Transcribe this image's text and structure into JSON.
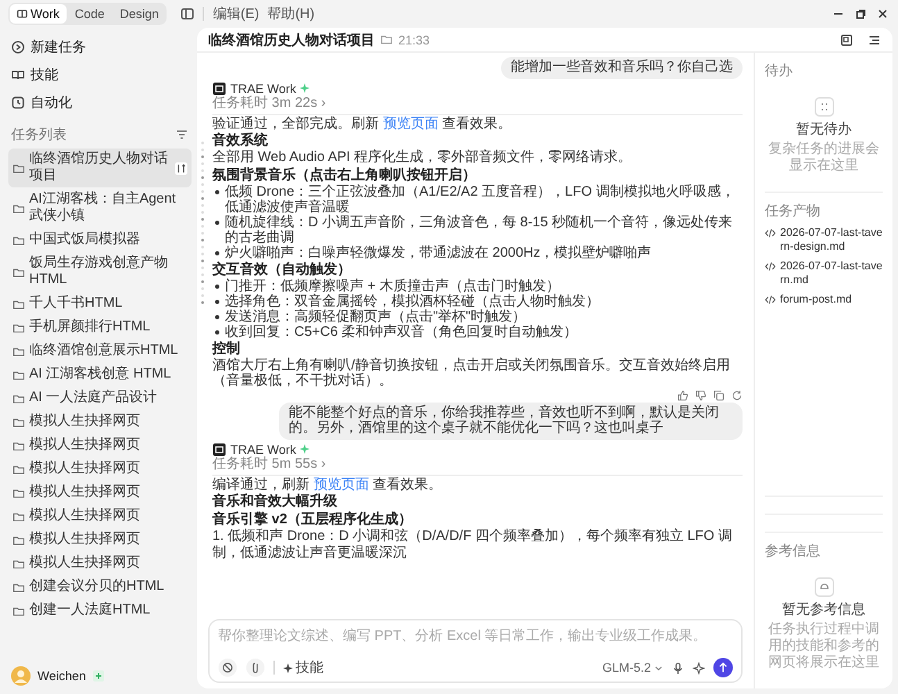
{
  "window": {
    "tabs": [
      {
        "label": "Work",
        "selected": true
      },
      {
        "label": "Code",
        "selected": false
      },
      {
        "label": "Design",
        "selected": false
      }
    ],
    "menus": [
      "编辑(E)",
      "帮助(H)"
    ]
  },
  "sidebar": {
    "nav": [
      {
        "label": "新建任务",
        "kind": "new"
      },
      {
        "label": "技能",
        "kind": "skills"
      },
      {
        "label": "自动化",
        "kind": "auto"
      }
    ],
    "list_title": "任务列表",
    "tasks": [
      {
        "label": "临终酒馆历史人物对话项目",
        "selected": true
      },
      {
        "label": "AI江湖客栈：自主Agent武侠小镇",
        "selected": false
      },
      {
        "label": "中国式饭局模拟器",
        "selected": false
      },
      {
        "label": "饭局生存游戏创意产物HTML",
        "selected": false
      },
      {
        "label": "千人千书HTML",
        "selected": false
      },
      {
        "label": "手机屏颜排行HTML",
        "selected": false
      },
      {
        "label": "临终酒馆创意展示HTML",
        "selected": false
      },
      {
        "label": "AI 江湖客栈创意 HTML",
        "selected": false
      },
      {
        "label": "AI 一人法庭产品设计",
        "selected": false
      },
      {
        "label": "模拟人生抉择网页",
        "selected": false
      },
      {
        "label": "模拟人生抉择网页",
        "selected": false
      },
      {
        "label": "模拟人生抉择网页",
        "selected": false
      },
      {
        "label": "模拟人生抉择网页",
        "selected": false
      },
      {
        "label": "模拟人生抉择网页",
        "selected": false
      },
      {
        "label": "模拟人生抉择网页",
        "selected": false
      },
      {
        "label": "模拟人生抉择网页",
        "selected": false
      },
      {
        "label": "创建会议分贝的HTML",
        "selected": false
      },
      {
        "label": "创建一人法庭HTML",
        "selected": false
      }
    ],
    "user": {
      "name": "Weichen"
    }
  },
  "conversation": {
    "title": "临终酒馆历史人物对话项目",
    "time": "21:33",
    "messages": [
      {
        "kind": "user",
        "text": "能增加一些音效和音乐吗？你自己选"
      },
      {
        "kind": "agent",
        "agent": "TRAE Work",
        "duration": "任务耗时 3m 22s ›",
        "actions": true,
        "blocks": [
          {
            "kind": "link_p",
            "before": "验证通过，全部完成。刷新 ",
            "link": "预览页面",
            "after": " 查看效果。"
          },
          {
            "kind": "h",
            "text": "音效系统"
          },
          {
            "kind": "p",
            "text": "全部用 Web Audio API 程序化生成，零外部音频文件，零网络请求。"
          },
          {
            "kind": "h",
            "text": "氛围背景音乐（点击右上角喇叭按钮开启）"
          },
          {
            "kind": "li",
            "text": "低频 Drone：三个正弦波叠加（A1/E2/A2 五度音程），LFO 调制模拟地火呼吸感，低通滤波使声音温暖"
          },
          {
            "kind": "li",
            "text": "随机旋律线：D 小调五声音阶，三角波音色，每 8-15 秒随机一个音符，像远处传来的古老曲调"
          },
          {
            "kind": "li",
            "text": "炉火噼啪声：白噪声轻微爆发，带通滤波在 2000Hz，模拟壁炉噼啪声"
          },
          {
            "kind": "h",
            "text": "交互音效（自动触发）"
          },
          {
            "kind": "li",
            "text": "门推开：低频摩擦噪声 + 木质撞击声（点击门时触发）"
          },
          {
            "kind": "li",
            "text": "选择角色：双音金属摇铃，模拟酒杯轻碰（点击人物时触发）"
          },
          {
            "kind": "li",
            "text": "发送消息：高频轻促翻页声（点击\"举杯\"时触发）"
          },
          {
            "kind": "li",
            "text": "收到回复：C5+C6 柔和钟声双音（角色回复时自动触发）"
          },
          {
            "kind": "h",
            "text": "控制"
          },
          {
            "kind": "p",
            "text": "酒馆大厅右上角有喇叭/静音切换按钮，点击开启或关闭氛围音乐。交互音效始终启用（音量极低，不干扰对话）。"
          }
        ]
      },
      {
        "kind": "user",
        "text": "能不能整个好点的音乐，你给我推荐些，音效也听不到啊，默认是关闭的。另外，酒馆里的这个桌子就不能优化一下吗？这也叫桌子"
      },
      {
        "kind": "agent",
        "agent": "TRAE Work",
        "duration": "任务耗时 5m 55s ›",
        "actions": false,
        "blocks": [
          {
            "kind": "link_p",
            "before": "编译通过，刷新 ",
            "link": "预览页面",
            "after": " 查看效果。"
          },
          {
            "kind": "h",
            "text": "音乐和音效大幅升级"
          },
          {
            "kind": "h",
            "text": "音乐引擎 v2（五层程序化生成）"
          },
          {
            "kind": "p",
            "text": "1. 低频和声 Drone：D 小调和弦（D/A/D/F 四个频率叠加），每个频率有独立 LFO 调制，低通滤波让声音更温暖深沉"
          }
        ]
      }
    ],
    "composer": {
      "placeholder": "帮你整理论文综述、编写 PPT、分析 Excel 等日常工作，输出专业级工作成果。",
      "skill": "技能",
      "model": "GLM-5.2"
    }
  },
  "panel": {
    "todo": {
      "title": "待办",
      "empty_title": "暂无待办",
      "empty_hint": "复杂任务的进展会显示在这里"
    },
    "outputs": {
      "title": "任务产物",
      "files": [
        "2026-07-07-last-tavern-design.md",
        "2026-07-07-last-tavern.md",
        "forum-post.md"
      ]
    },
    "refs": {
      "title": "参考信息",
      "empty_title": "暂无参考信息",
      "empty_hint": "任务执行过程中调用的技能和参考的网页将展示在这里"
    }
  }
}
